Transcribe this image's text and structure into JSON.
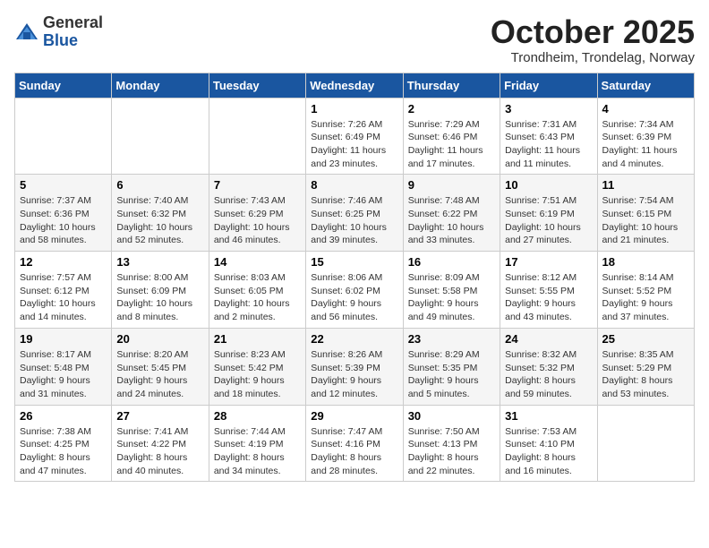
{
  "header": {
    "logo_general": "General",
    "logo_blue": "Blue",
    "month_title": "October 2025",
    "location": "Trondheim, Trondelag, Norway"
  },
  "days_of_week": [
    "Sunday",
    "Monday",
    "Tuesday",
    "Wednesday",
    "Thursday",
    "Friday",
    "Saturday"
  ],
  "weeks": [
    [
      {
        "day": "",
        "info": ""
      },
      {
        "day": "",
        "info": ""
      },
      {
        "day": "",
        "info": ""
      },
      {
        "day": "1",
        "info": "Sunrise: 7:26 AM\nSunset: 6:49 PM\nDaylight: 11 hours\nand 23 minutes."
      },
      {
        "day": "2",
        "info": "Sunrise: 7:29 AM\nSunset: 6:46 PM\nDaylight: 11 hours\nand 17 minutes."
      },
      {
        "day": "3",
        "info": "Sunrise: 7:31 AM\nSunset: 6:43 PM\nDaylight: 11 hours\nand 11 minutes."
      },
      {
        "day": "4",
        "info": "Sunrise: 7:34 AM\nSunset: 6:39 PM\nDaylight: 11 hours\nand 4 minutes."
      }
    ],
    [
      {
        "day": "5",
        "info": "Sunrise: 7:37 AM\nSunset: 6:36 PM\nDaylight: 10 hours\nand 58 minutes."
      },
      {
        "day": "6",
        "info": "Sunrise: 7:40 AM\nSunset: 6:32 PM\nDaylight: 10 hours\nand 52 minutes."
      },
      {
        "day": "7",
        "info": "Sunrise: 7:43 AM\nSunset: 6:29 PM\nDaylight: 10 hours\nand 46 minutes."
      },
      {
        "day": "8",
        "info": "Sunrise: 7:46 AM\nSunset: 6:25 PM\nDaylight: 10 hours\nand 39 minutes."
      },
      {
        "day": "9",
        "info": "Sunrise: 7:48 AM\nSunset: 6:22 PM\nDaylight: 10 hours\nand 33 minutes."
      },
      {
        "day": "10",
        "info": "Sunrise: 7:51 AM\nSunset: 6:19 PM\nDaylight: 10 hours\nand 27 minutes."
      },
      {
        "day": "11",
        "info": "Sunrise: 7:54 AM\nSunset: 6:15 PM\nDaylight: 10 hours\nand 21 minutes."
      }
    ],
    [
      {
        "day": "12",
        "info": "Sunrise: 7:57 AM\nSunset: 6:12 PM\nDaylight: 10 hours\nand 14 minutes."
      },
      {
        "day": "13",
        "info": "Sunrise: 8:00 AM\nSunset: 6:09 PM\nDaylight: 10 hours\nand 8 minutes."
      },
      {
        "day": "14",
        "info": "Sunrise: 8:03 AM\nSunset: 6:05 PM\nDaylight: 10 hours\nand 2 minutes."
      },
      {
        "day": "15",
        "info": "Sunrise: 8:06 AM\nSunset: 6:02 PM\nDaylight: 9 hours\nand 56 minutes."
      },
      {
        "day": "16",
        "info": "Sunrise: 8:09 AM\nSunset: 5:58 PM\nDaylight: 9 hours\nand 49 minutes."
      },
      {
        "day": "17",
        "info": "Sunrise: 8:12 AM\nSunset: 5:55 PM\nDaylight: 9 hours\nand 43 minutes."
      },
      {
        "day": "18",
        "info": "Sunrise: 8:14 AM\nSunset: 5:52 PM\nDaylight: 9 hours\nand 37 minutes."
      }
    ],
    [
      {
        "day": "19",
        "info": "Sunrise: 8:17 AM\nSunset: 5:48 PM\nDaylight: 9 hours\nand 31 minutes."
      },
      {
        "day": "20",
        "info": "Sunrise: 8:20 AM\nSunset: 5:45 PM\nDaylight: 9 hours\nand 24 minutes."
      },
      {
        "day": "21",
        "info": "Sunrise: 8:23 AM\nSunset: 5:42 PM\nDaylight: 9 hours\nand 18 minutes."
      },
      {
        "day": "22",
        "info": "Sunrise: 8:26 AM\nSunset: 5:39 PM\nDaylight: 9 hours\nand 12 minutes."
      },
      {
        "day": "23",
        "info": "Sunrise: 8:29 AM\nSunset: 5:35 PM\nDaylight: 9 hours\nand 5 minutes."
      },
      {
        "day": "24",
        "info": "Sunrise: 8:32 AM\nSunset: 5:32 PM\nDaylight: 8 hours\nand 59 minutes."
      },
      {
        "day": "25",
        "info": "Sunrise: 8:35 AM\nSunset: 5:29 PM\nDaylight: 8 hours\nand 53 minutes."
      }
    ],
    [
      {
        "day": "26",
        "info": "Sunrise: 7:38 AM\nSunset: 4:25 PM\nDaylight: 8 hours\nand 47 minutes."
      },
      {
        "day": "27",
        "info": "Sunrise: 7:41 AM\nSunset: 4:22 PM\nDaylight: 8 hours\nand 40 minutes."
      },
      {
        "day": "28",
        "info": "Sunrise: 7:44 AM\nSunset: 4:19 PM\nDaylight: 8 hours\nand 34 minutes."
      },
      {
        "day": "29",
        "info": "Sunrise: 7:47 AM\nSunset: 4:16 PM\nDaylight: 8 hours\nand 28 minutes."
      },
      {
        "day": "30",
        "info": "Sunrise: 7:50 AM\nSunset: 4:13 PM\nDaylight: 8 hours\nand 22 minutes."
      },
      {
        "day": "31",
        "info": "Sunrise: 7:53 AM\nSunset: 4:10 PM\nDaylight: 8 hours\nand 16 minutes."
      },
      {
        "day": "",
        "info": ""
      }
    ]
  ]
}
